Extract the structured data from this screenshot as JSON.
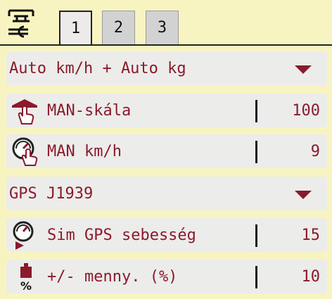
{
  "header": {
    "tool_icon": "settings-tools-icon",
    "tabs": [
      {
        "label": "1",
        "active": true
      },
      {
        "label": "2",
        "active": false
      },
      {
        "label": "3",
        "active": false
      }
    ]
  },
  "rows": [
    {
      "type": "dropdown",
      "label": "Auto km/h + Auto kg"
    },
    {
      "type": "value",
      "icon": "man-scale-icon",
      "label": "MAN-skála",
      "value": "100"
    },
    {
      "type": "value",
      "icon": "man-speed-icon",
      "label": "MAN km/h",
      "value": "9"
    },
    {
      "type": "dropdown",
      "label": "GPS J1939"
    },
    {
      "type": "value",
      "icon": "sim-gps-speed-icon",
      "label": "Sim GPS sebesség",
      "value": "15"
    },
    {
      "type": "value",
      "icon": "quantity-percent-icon",
      "label": "+/- menny. (%)",
      "value": "10"
    }
  ],
  "colors": {
    "text": "#8b1a2b",
    "background": "#f7f4c2",
    "row": "#ececeb"
  }
}
